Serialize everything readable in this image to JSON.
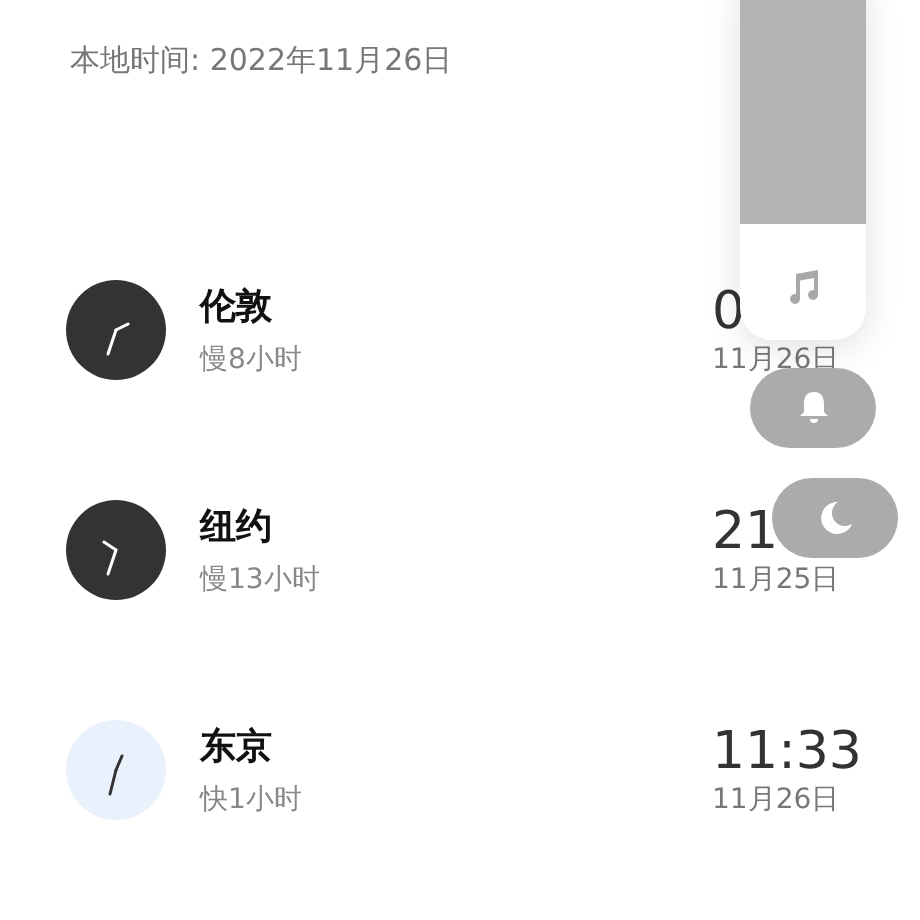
{
  "local_time": "本地时间: 2022年11月26日",
  "cities": [
    {
      "name": "伦敦",
      "offset": "慢8小时",
      "time": "0",
      "date": "11月26日",
      "kind": "night"
    },
    {
      "name": "纽约",
      "offset": "慢13小时",
      "time": "21",
      "date": "11月25日",
      "kind": "night"
    },
    {
      "name": "东京",
      "offset": "快1小时",
      "time": "11:33",
      "date": "11月26日",
      "kind": "day"
    }
  ]
}
